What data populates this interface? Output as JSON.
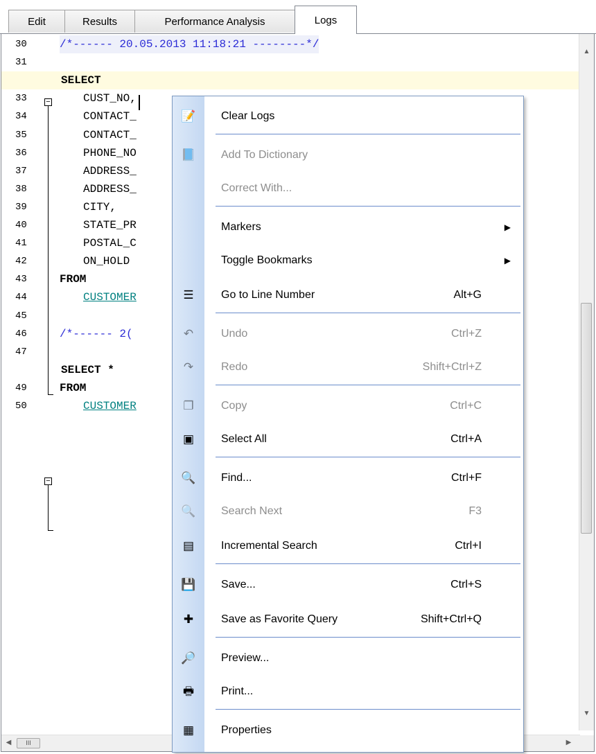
{
  "tabs": [
    {
      "label": "Edit"
    },
    {
      "label": "Results"
    },
    {
      "label": "Performance Analysis"
    },
    {
      "label": "Logs"
    }
  ],
  "active_tab": "Logs",
  "code_lines": [
    {
      "num": "30",
      "text": "/*------ 20.05.2013 11:18:21 --------*/"
    },
    {
      "num": "31",
      "text": ""
    },
    {
      "num": "",
      "text": "SELECT"
    },
    {
      "num": "33",
      "text": "CUST_NO,"
    },
    {
      "num": "34",
      "text": "CONTACT_"
    },
    {
      "num": "35",
      "text": "CONTACT_"
    },
    {
      "num": "36",
      "text": "PHONE_NO"
    },
    {
      "num": "37",
      "text": "ADDRESS_"
    },
    {
      "num": "38",
      "text": "ADDRESS_"
    },
    {
      "num": "39",
      "text": "CITY,"
    },
    {
      "num": "40",
      "text": "STATE_PR"
    },
    {
      "num": "41",
      "text": "POSTAL_C"
    },
    {
      "num": "42",
      "text": "ON_HOLD"
    },
    {
      "num": "43",
      "text": "FROM"
    },
    {
      "num": "44",
      "text": "CUSTOMER"
    },
    {
      "num": "45",
      "text": ""
    },
    {
      "num": "46",
      "text": "/*------ 2("
    },
    {
      "num": "47",
      "text": ""
    },
    {
      "num": "",
      "text": "SELECT *"
    },
    {
      "num": "49",
      "text": "FROM"
    },
    {
      "num": "50",
      "text": "CUSTOMER"
    }
  ],
  "hscroll_grip": "III",
  "menu": {
    "items": [
      {
        "label": "Clear Logs",
        "shortcut": "",
        "icon": "clear-logs-icon",
        "enabled": true
      },
      {
        "label": "Add To Dictionary",
        "shortcut": "",
        "icon": "dictionary-icon",
        "enabled": false
      },
      {
        "label": "Correct With...",
        "shortcut": "",
        "icon": "",
        "enabled": false
      },
      {
        "label": "Markers",
        "shortcut": "",
        "icon": "",
        "enabled": true,
        "submenu": true
      },
      {
        "label": "Toggle Bookmarks",
        "shortcut": "",
        "icon": "",
        "enabled": true,
        "submenu": true
      },
      {
        "label": "Go to Line Number",
        "shortcut": "Alt+G",
        "icon": "goto-line-icon",
        "enabled": true
      },
      {
        "label": "Undo",
        "shortcut": "Ctrl+Z",
        "icon": "undo-icon",
        "enabled": false
      },
      {
        "label": "Redo",
        "shortcut": "Shift+Ctrl+Z",
        "icon": "redo-icon",
        "enabled": false
      },
      {
        "label": "Copy",
        "shortcut": "Ctrl+C",
        "icon": "copy-icon",
        "enabled": false
      },
      {
        "label": "Select All",
        "shortcut": "Ctrl+A",
        "icon": "select-all-icon",
        "enabled": true
      },
      {
        "label": "Find...",
        "shortcut": "Ctrl+F",
        "icon": "find-icon",
        "enabled": true
      },
      {
        "label": "Search Next",
        "shortcut": "F3",
        "icon": "search-next-icon",
        "enabled": false
      },
      {
        "label": "Incremental Search",
        "shortcut": "Ctrl+I",
        "icon": "incremental-search-icon",
        "enabled": true
      },
      {
        "label": "Save...",
        "shortcut": "Ctrl+S",
        "icon": "save-icon",
        "enabled": true
      },
      {
        "label": "Save as Favorite Query",
        "shortcut": "Shift+Ctrl+Q",
        "icon": "favorite-query-icon",
        "enabled": true
      },
      {
        "label": "Preview...",
        "shortcut": "",
        "icon": "preview-icon",
        "enabled": true
      },
      {
        "label": "Print...",
        "shortcut": "",
        "icon": "print-icon",
        "enabled": true
      },
      {
        "label": "Properties",
        "shortcut": "",
        "icon": "properties-icon",
        "enabled": true
      }
    ],
    "submenu_arrow": "▶"
  },
  "colors": {
    "accent": "#6a8ccb",
    "comment": "#2b2bd6",
    "table_link": "#008080",
    "current_line": "#fffbe0"
  }
}
